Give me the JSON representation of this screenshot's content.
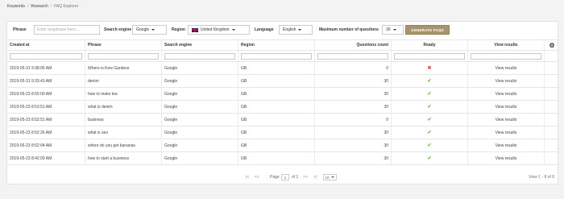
{
  "breadcrumb": {
    "items": [
      "Keywords",
      "Research",
      "FAQ Explorer"
    ],
    "separator": "/"
  },
  "toolbar": {
    "phrase_label": "Phrase",
    "phrase_placeholder": "Enter keyphrase here...",
    "engine_label": "Search engine",
    "engine_value": "Google",
    "region_label": "Region",
    "region_value": "United Kingdom",
    "language_label": "Language",
    "language_value": "English",
    "max_label": "Maximum number of questions",
    "max_value": "30",
    "generate_label": "GENERATE FAQS",
    "generate_color": "#a8946a"
  },
  "table": {
    "columns": [
      "Created at",
      "Phrase",
      "Search engine",
      "Region",
      "Questions count",
      "Ready",
      "View results"
    ],
    "rows": [
      {
        "created": "2019-05-31 9:38:05 AM",
        "phrase": "Where is Kew Gardens",
        "engine": "Google",
        "region": "GB",
        "count": "0",
        "ready": "no",
        "view": "View results"
      },
      {
        "created": "2019-05-31 9:33:43 AM",
        "phrase": "denim",
        "engine": "Google",
        "region": "GB",
        "count": "30",
        "ready": "yes",
        "view": "View results"
      },
      {
        "created": "2019-05-23 8:55:00 AM",
        "phrase": "how to make tea",
        "engine": "Google",
        "region": "GB",
        "count": "30",
        "ready": "yes",
        "view": "View results"
      },
      {
        "created": "2019-05-23 8:53:51 AM",
        "phrase": "what is denim",
        "engine": "Google",
        "region": "GB",
        "count": "30",
        "ready": "yes",
        "view": "View results"
      },
      {
        "created": "2019-05-23 8:52:51 AM",
        "phrase": "business",
        "engine": "Google",
        "region": "GB",
        "count": "0",
        "ready": "yes",
        "view": "View results"
      },
      {
        "created": "2019-05-23 8:52:26 AM",
        "phrase": "what is seo",
        "engine": "Google",
        "region": "GB",
        "count": "30",
        "ready": "yes",
        "view": "View results"
      },
      {
        "created": "2019-05-23 8:52:04 AM",
        "phrase": "where do you get bananas",
        "engine": "Google",
        "region": "GB",
        "count": "30",
        "ready": "yes",
        "view": "View results"
      },
      {
        "created": "2019-05-23 8:42:09 AM",
        "phrase": "how to start a business",
        "engine": "Google",
        "region": "GB",
        "count": "30",
        "ready": "yes",
        "view": "View results"
      }
    ],
    "ready_colors": {
      "yes": "#6ab04c",
      "no": "#d9534f"
    }
  },
  "pager": {
    "first": "|<",
    "prev": "<<",
    "page_label": "Page",
    "page_value": "1",
    "of_label": "of 1",
    "next": ">>",
    "last": ">|",
    "page_size": "10",
    "summary": "View 1 - 8 of 8"
  }
}
